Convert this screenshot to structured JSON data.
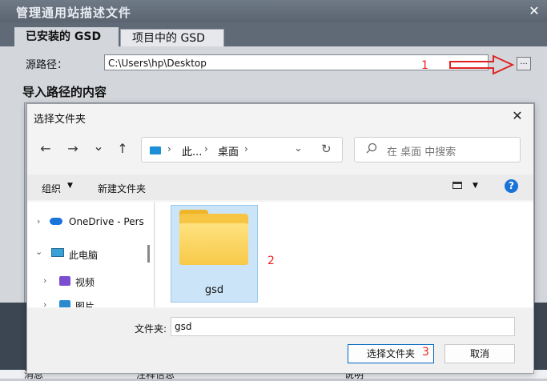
{
  "background_dialog": {
    "title": "管理通用站描述文件",
    "close_glyph": "✕",
    "tabs": [
      "已安装的 GSD",
      "项目中的 GSD"
    ],
    "source_path_label": "源路径：",
    "source_path_value": "C:\\Users\\hp\\Desktop",
    "browse_glyph": "...",
    "import_heading": "导入路径的内容",
    "table_columns": [
      "消息",
      "注释信息",
      "说明"
    ]
  },
  "annotations": [
    "1",
    "2",
    "3"
  ],
  "folder_picker": {
    "title": "选择文件夹",
    "close_glyph": "✕",
    "nav": {
      "back": "←",
      "forward": "→",
      "recent": "⌄",
      "up": "↑"
    },
    "address": {
      "seg1": "此...",
      "seg2": "桌面",
      "sep": "›",
      "dropdown": "⌄",
      "refresh": "↻"
    },
    "search_placeholder": "在 桌面 中搜索",
    "toolbar": {
      "organize": "组织",
      "new_folder": "新建文件夹",
      "caret": "▼",
      "help": "?"
    },
    "tree": [
      {
        "label": "OneDrive - Pers",
        "chevron": "›",
        "icon": "cloud-icon"
      },
      {
        "label": "此电脑",
        "chevron": "⌄",
        "icon": "pc-icon"
      },
      {
        "label": "视频",
        "chevron": "›",
        "icon": "video-icon"
      },
      {
        "label": "图片",
        "chevron": "›",
        "icon": "picture-icon"
      }
    ],
    "folder": {
      "name": "gsd"
    },
    "footer": {
      "folder_label": "文件夹:",
      "folder_value": "gsd",
      "select_button": "选择文件夹",
      "cancel_button": "取消"
    }
  },
  "colors": {
    "annotation": "#e22222",
    "accent": "#0067c0",
    "folder": "#f6c544"
  }
}
